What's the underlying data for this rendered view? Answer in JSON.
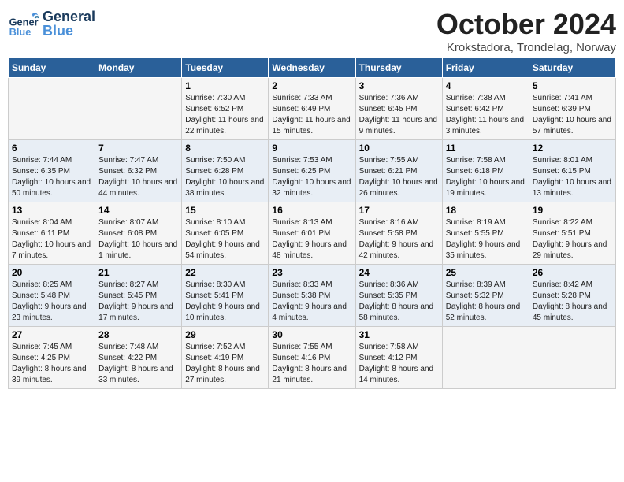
{
  "header": {
    "logo_general": "General",
    "logo_blue": "Blue",
    "month": "October 2024",
    "location": "Krokstadora, Trondelag, Norway"
  },
  "weekdays": [
    "Sunday",
    "Monday",
    "Tuesday",
    "Wednesday",
    "Thursday",
    "Friday",
    "Saturday"
  ],
  "weeks": [
    [
      {
        "day": "",
        "info": ""
      },
      {
        "day": "",
        "info": ""
      },
      {
        "day": "1",
        "info": "Sunrise: 7:30 AM\nSunset: 6:52 PM\nDaylight: 11 hours and 22 minutes."
      },
      {
        "day": "2",
        "info": "Sunrise: 7:33 AM\nSunset: 6:49 PM\nDaylight: 11 hours and 15 minutes."
      },
      {
        "day": "3",
        "info": "Sunrise: 7:36 AM\nSunset: 6:45 PM\nDaylight: 11 hours and 9 minutes."
      },
      {
        "day": "4",
        "info": "Sunrise: 7:38 AM\nSunset: 6:42 PM\nDaylight: 11 hours and 3 minutes."
      },
      {
        "day": "5",
        "info": "Sunrise: 7:41 AM\nSunset: 6:39 PM\nDaylight: 10 hours and 57 minutes."
      }
    ],
    [
      {
        "day": "6",
        "info": "Sunrise: 7:44 AM\nSunset: 6:35 PM\nDaylight: 10 hours and 50 minutes."
      },
      {
        "day": "7",
        "info": "Sunrise: 7:47 AM\nSunset: 6:32 PM\nDaylight: 10 hours and 44 minutes."
      },
      {
        "day": "8",
        "info": "Sunrise: 7:50 AM\nSunset: 6:28 PM\nDaylight: 10 hours and 38 minutes."
      },
      {
        "day": "9",
        "info": "Sunrise: 7:53 AM\nSunset: 6:25 PM\nDaylight: 10 hours and 32 minutes."
      },
      {
        "day": "10",
        "info": "Sunrise: 7:55 AM\nSunset: 6:21 PM\nDaylight: 10 hours and 26 minutes."
      },
      {
        "day": "11",
        "info": "Sunrise: 7:58 AM\nSunset: 6:18 PM\nDaylight: 10 hours and 19 minutes."
      },
      {
        "day": "12",
        "info": "Sunrise: 8:01 AM\nSunset: 6:15 PM\nDaylight: 10 hours and 13 minutes."
      }
    ],
    [
      {
        "day": "13",
        "info": "Sunrise: 8:04 AM\nSunset: 6:11 PM\nDaylight: 10 hours and 7 minutes."
      },
      {
        "day": "14",
        "info": "Sunrise: 8:07 AM\nSunset: 6:08 PM\nDaylight: 10 hours and 1 minute."
      },
      {
        "day": "15",
        "info": "Sunrise: 8:10 AM\nSunset: 6:05 PM\nDaylight: 9 hours and 54 minutes."
      },
      {
        "day": "16",
        "info": "Sunrise: 8:13 AM\nSunset: 6:01 PM\nDaylight: 9 hours and 48 minutes."
      },
      {
        "day": "17",
        "info": "Sunrise: 8:16 AM\nSunset: 5:58 PM\nDaylight: 9 hours and 42 minutes."
      },
      {
        "day": "18",
        "info": "Sunrise: 8:19 AM\nSunset: 5:55 PM\nDaylight: 9 hours and 35 minutes."
      },
      {
        "day": "19",
        "info": "Sunrise: 8:22 AM\nSunset: 5:51 PM\nDaylight: 9 hours and 29 minutes."
      }
    ],
    [
      {
        "day": "20",
        "info": "Sunrise: 8:25 AM\nSunset: 5:48 PM\nDaylight: 9 hours and 23 minutes."
      },
      {
        "day": "21",
        "info": "Sunrise: 8:27 AM\nSunset: 5:45 PM\nDaylight: 9 hours and 17 minutes."
      },
      {
        "day": "22",
        "info": "Sunrise: 8:30 AM\nSunset: 5:41 PM\nDaylight: 9 hours and 10 minutes."
      },
      {
        "day": "23",
        "info": "Sunrise: 8:33 AM\nSunset: 5:38 PM\nDaylight: 9 hours and 4 minutes."
      },
      {
        "day": "24",
        "info": "Sunrise: 8:36 AM\nSunset: 5:35 PM\nDaylight: 8 hours and 58 minutes."
      },
      {
        "day": "25",
        "info": "Sunrise: 8:39 AM\nSunset: 5:32 PM\nDaylight: 8 hours and 52 minutes."
      },
      {
        "day": "26",
        "info": "Sunrise: 8:42 AM\nSunset: 5:28 PM\nDaylight: 8 hours and 45 minutes."
      }
    ],
    [
      {
        "day": "27",
        "info": "Sunrise: 7:45 AM\nSunset: 4:25 PM\nDaylight: 8 hours and 39 minutes."
      },
      {
        "day": "28",
        "info": "Sunrise: 7:48 AM\nSunset: 4:22 PM\nDaylight: 8 hours and 33 minutes."
      },
      {
        "day": "29",
        "info": "Sunrise: 7:52 AM\nSunset: 4:19 PM\nDaylight: 8 hours and 27 minutes."
      },
      {
        "day": "30",
        "info": "Sunrise: 7:55 AM\nSunset: 4:16 PM\nDaylight: 8 hours and 21 minutes."
      },
      {
        "day": "31",
        "info": "Sunrise: 7:58 AM\nSunset: 4:12 PM\nDaylight: 8 hours and 14 minutes."
      },
      {
        "day": "",
        "info": ""
      },
      {
        "day": "",
        "info": ""
      }
    ]
  ]
}
